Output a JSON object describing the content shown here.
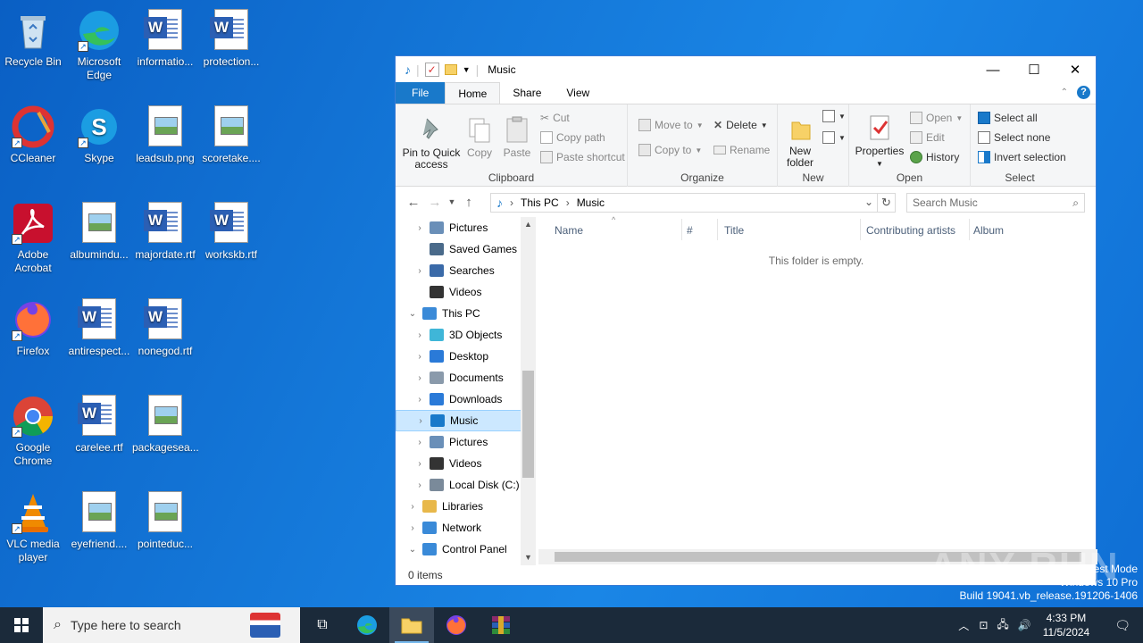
{
  "desktop": {
    "icons": [
      {
        "label": "Recycle Bin"
      },
      {
        "label": "Microsoft Edge"
      },
      {
        "label": "informatio..."
      },
      {
        "label": "protection..."
      },
      {
        "label": "CCleaner"
      },
      {
        "label": "Skype"
      },
      {
        "label": "leadsub.png"
      },
      {
        "label": "scoretake...."
      },
      {
        "label": "Adobe Acrobat"
      },
      {
        "label": "albumindu..."
      },
      {
        "label": "majordate.rtf"
      },
      {
        "label": "workskb.rtf"
      },
      {
        "label": "Firefox"
      },
      {
        "label": "antirespect..."
      },
      {
        "label": "nonegod.rtf"
      },
      {
        "label": "Google Chrome"
      },
      {
        "label": "carelee.rtf"
      },
      {
        "label": "packagesea..."
      },
      {
        "label": "VLC media player"
      },
      {
        "label": "eyefriend...."
      },
      {
        "label": "pointeduc..."
      }
    ]
  },
  "explorer": {
    "title": "Music",
    "tabs": {
      "file": "File",
      "home": "Home",
      "share": "Share",
      "view": "View"
    },
    "ribbon": {
      "clipboard": {
        "label": "Clipboard",
        "pin": "Pin to Quick access",
        "copy": "Copy",
        "paste": "Paste",
        "cut": "Cut",
        "copy_path": "Copy path",
        "paste_shortcut": "Paste shortcut"
      },
      "organize": {
        "label": "Organize",
        "move_to": "Move to",
        "copy_to": "Copy to",
        "delete": "Delete",
        "rename": "Rename"
      },
      "new": {
        "label": "New",
        "new_folder": "New folder"
      },
      "open": {
        "label": "Open",
        "properties": "Properties",
        "open": "Open",
        "edit": "Edit",
        "history": "History"
      },
      "select": {
        "label": "Select",
        "select_all": "Select all",
        "select_none": "Select none",
        "invert": "Invert selection"
      }
    },
    "address": {
      "this_pc": "This PC",
      "music": "Music"
    },
    "search_placeholder": "Search Music",
    "nav": [
      {
        "label": "Pictures",
        "chev": ">"
      },
      {
        "label": "Saved Games",
        "chev": ""
      },
      {
        "label": "Searches",
        "chev": ">"
      },
      {
        "label": "Videos",
        "chev": ""
      },
      {
        "label": "This PC",
        "chev": "v"
      },
      {
        "label": "3D Objects",
        "chev": ">"
      },
      {
        "label": "Desktop",
        "chev": ">"
      },
      {
        "label": "Documents",
        "chev": ">"
      },
      {
        "label": "Downloads",
        "chev": ">"
      },
      {
        "label": "Music",
        "chev": ">"
      },
      {
        "label": "Pictures",
        "chev": ">"
      },
      {
        "label": "Videos",
        "chev": ">"
      },
      {
        "label": "Local Disk (C:)",
        "chev": ">"
      },
      {
        "label": "Libraries",
        "chev": ">"
      },
      {
        "label": "Network",
        "chev": ">"
      },
      {
        "label": "Control Panel",
        "chev": "v"
      }
    ],
    "columns": {
      "name": "Name",
      "num": "#",
      "title": "Title",
      "artists": "Contributing artists",
      "album": "Album"
    },
    "empty_text": "This folder is empty.",
    "status": "0 items"
  },
  "taskbar": {
    "search_placeholder": "Type here to search",
    "time": "4:33 PM",
    "date": "11/5/2024"
  },
  "watermark": {
    "line1": "Test Mode",
    "line2": "Windows 10 Pro",
    "line3": "Build 19041.vb_release.191206-1406",
    "brand": "ANY RUN"
  },
  "colors": {
    "accent": "#1979ca",
    "selection": "#cce8ff",
    "taskbar": "#1b2a3a"
  }
}
